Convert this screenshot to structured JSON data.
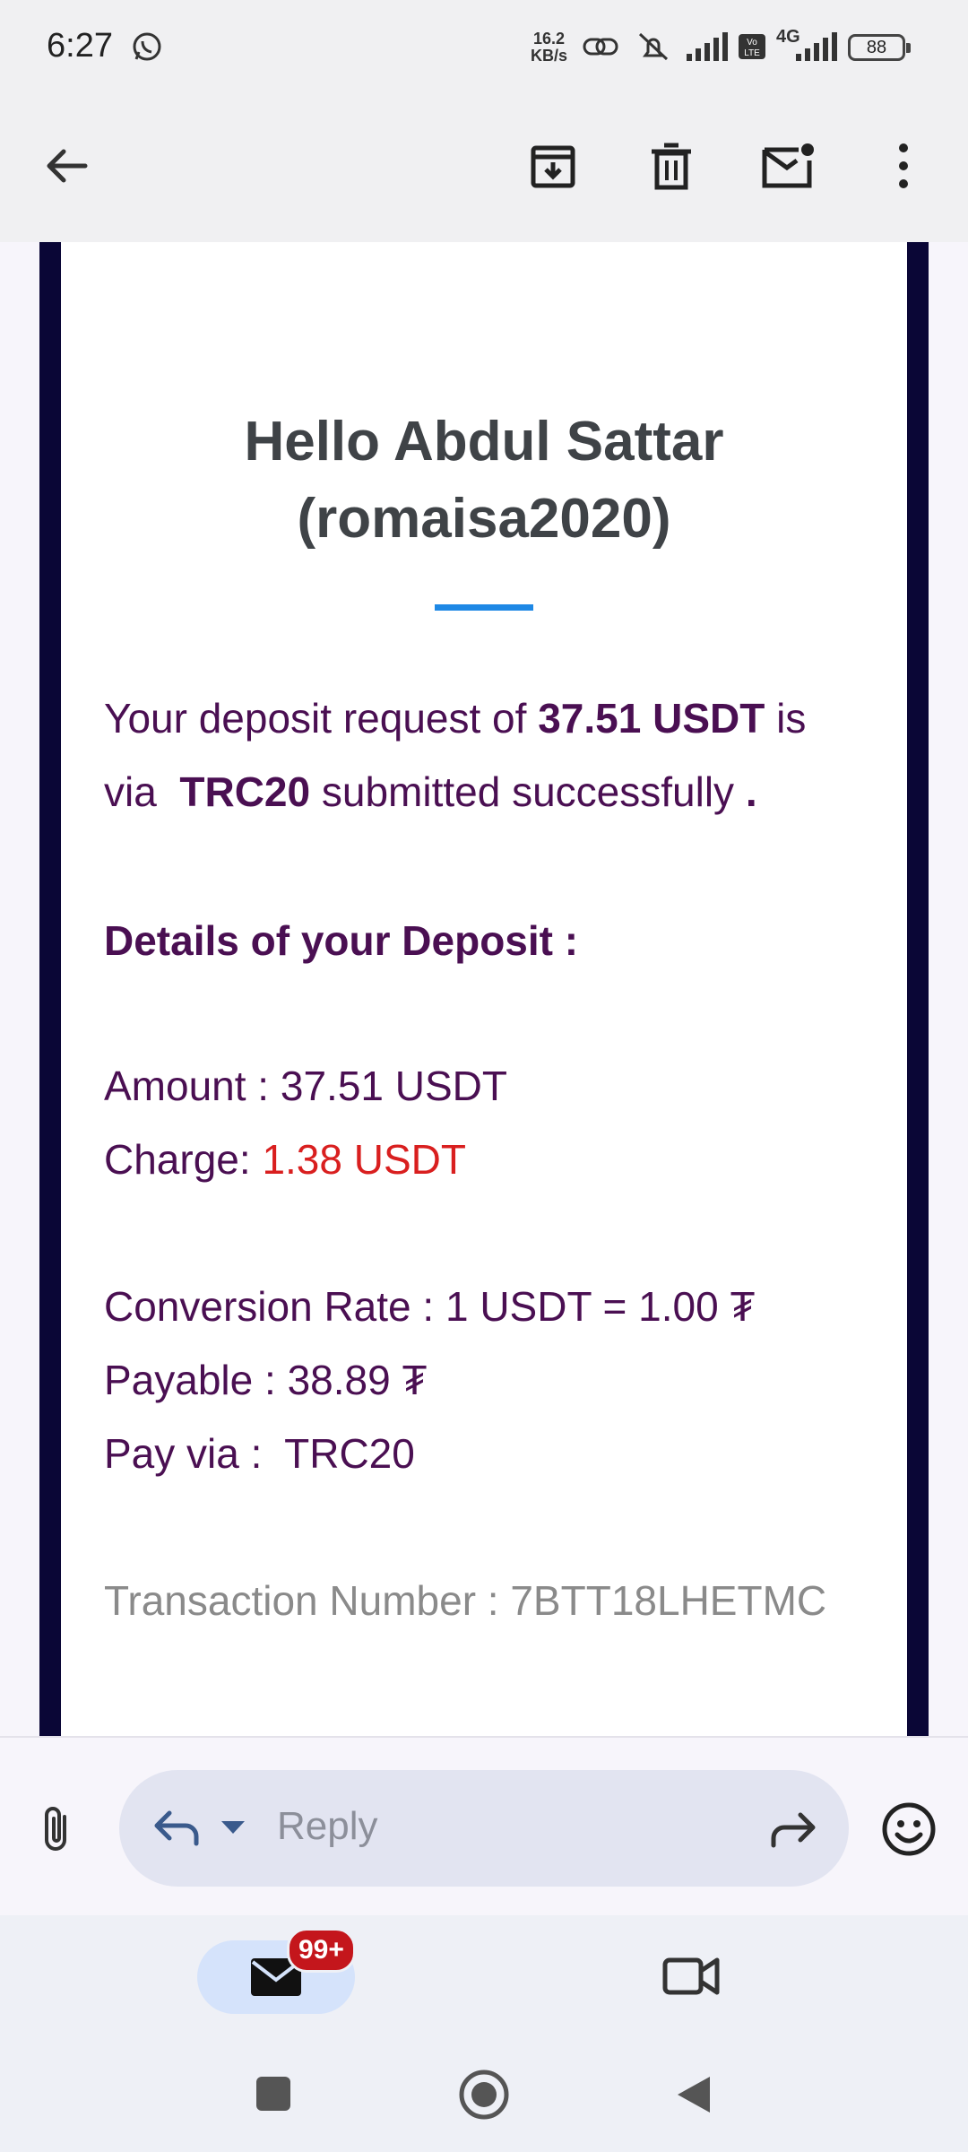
{
  "status_bar": {
    "time": "6:27",
    "net_speed_value": "16.2",
    "net_speed_unit": "KB/s",
    "network": "4G",
    "battery": "88",
    "icons": [
      "whatsapp-icon",
      "link-icon",
      "mute-icon",
      "signal-icon",
      "volte-icon",
      "signal-4g-icon"
    ]
  },
  "toolbar": {
    "icons": [
      "back-arrow-icon",
      "archive-icon",
      "delete-icon",
      "mark-unread-icon",
      "more-options-icon"
    ]
  },
  "email": {
    "greeting": "Hello Abdul Sattar (romaisa2020)",
    "line1_a": "Your deposit request of ",
    "line1_amount": "37.51 USDT",
    "line1_b": " is",
    "line2_a": "via  ",
    "line2_network": "TRC20",
    "line2_b": " submitted successfully ",
    "line2_dot": ".",
    "details_heading": "Details of your Deposit :",
    "amount": "Amount : 37.51 USDT",
    "charge_label": "Charge: ",
    "charge_value": "1.38 USDT",
    "conversion": "Conversion Rate : 1 USDT = 1.00 ₮",
    "payable": "Payable : 38.89 ₮",
    "pay_via": "Pay via :  TRC20",
    "transaction": "Transaction Number : 7BTT18LHETMC",
    "accent_color": "#1e88e5",
    "text_color": "#4a0f52",
    "charge_color": "#d91f1f"
  },
  "reply_bar": {
    "placeholder": "Reply",
    "icons": [
      "attach-icon",
      "reply-icon",
      "reply-dropdown-icon",
      "forward-icon",
      "emoji-icon"
    ]
  },
  "bottom_nav": {
    "mail_badge": "99+",
    "icons": [
      "mail-icon",
      "meet-video-icon"
    ]
  },
  "system_nav": {
    "icons": [
      "recents-square-icon",
      "home-circle-icon",
      "back-triangle-icon"
    ]
  }
}
